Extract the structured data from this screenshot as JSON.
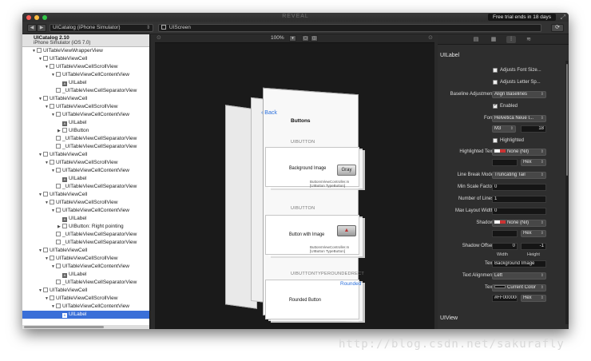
{
  "window": {
    "app_title": "REVEAL",
    "trial_text": "Free trial ends in 18 days"
  },
  "toolbar": {
    "app_selector": "UICatalog (iPhone Simulator)",
    "breadcrumb": "UIScreen"
  },
  "tree": {
    "app_name": "UICatalog 2.10",
    "device": "iPhone Simulator (iOS 7.0)",
    "nodes": [
      {
        "indent": 52,
        "tw": "▼",
        "icon": "box",
        "label": "UITableViewWrapperView"
      },
      {
        "indent": 60,
        "tw": "▼",
        "icon": "box",
        "label": "UITableViewCell"
      },
      {
        "indent": 68,
        "tw": "▼",
        "icon": "box",
        "label": "UITableViewCellScrollView"
      },
      {
        "indent": 76,
        "tw": "▼",
        "icon": "dash",
        "label": "UITableViewCellContentView"
      },
      {
        "indent": 84,
        "tw": "",
        "icon": "lbl",
        "label": "UILabel"
      },
      {
        "indent": 76,
        "tw": "",
        "icon": "dash",
        "label": "_UITableViewCellSeparatorView"
      },
      {
        "indent": 60,
        "tw": "▼",
        "icon": "box",
        "label": "UITableViewCell"
      },
      {
        "indent": 68,
        "tw": "▼",
        "icon": "box",
        "label": "UITableViewCellScrollView"
      },
      {
        "indent": 76,
        "tw": "▼",
        "icon": "dash",
        "label": "UITableViewCellContentView"
      },
      {
        "indent": 84,
        "tw": "",
        "icon": "lbl",
        "label": "UILabel"
      },
      {
        "indent": 84,
        "tw": "▶",
        "icon": "box",
        "label": "UIButton"
      },
      {
        "indent": 76,
        "tw": "",
        "icon": "dash",
        "label": "_UITableViewCellSeparatorView"
      },
      {
        "indent": 76,
        "tw": "",
        "icon": "dash",
        "label": "_UITableViewCellSeparatorView"
      },
      {
        "indent": 60,
        "tw": "▼",
        "icon": "box",
        "label": "UITableViewCell"
      },
      {
        "indent": 68,
        "tw": "▼",
        "icon": "box",
        "label": "UITableViewCellScrollView"
      },
      {
        "indent": 76,
        "tw": "▼",
        "icon": "dash",
        "label": "UITableViewCellContentView"
      },
      {
        "indent": 84,
        "tw": "",
        "icon": "lbl",
        "label": "UILabel"
      },
      {
        "indent": 76,
        "tw": "",
        "icon": "dash",
        "label": "_UITableViewCellSeparatorView"
      },
      {
        "indent": 60,
        "tw": "▼",
        "icon": "box",
        "label": "UITableViewCell"
      },
      {
        "indent": 68,
        "tw": "▼",
        "icon": "box",
        "label": "UITableViewCellScrollView"
      },
      {
        "indent": 76,
        "tw": "▼",
        "icon": "dash",
        "label": "UITableViewCellContentView"
      },
      {
        "indent": 84,
        "tw": "",
        "icon": "lbl",
        "label": "UILabel"
      },
      {
        "indent": 84,
        "tw": "▶",
        "icon": "box",
        "label": "UIButton: Right pointing"
      },
      {
        "indent": 76,
        "tw": "",
        "icon": "dash",
        "label": "_UITableViewCellSeparatorView"
      },
      {
        "indent": 76,
        "tw": "",
        "icon": "dash",
        "label": "_UITableViewCellSeparatorView"
      },
      {
        "indent": 60,
        "tw": "▼",
        "icon": "box",
        "label": "UITableViewCell"
      },
      {
        "indent": 68,
        "tw": "▼",
        "icon": "box",
        "label": "UITableViewCellScrollView"
      },
      {
        "indent": 76,
        "tw": "▼",
        "icon": "dash",
        "label": "UITableViewCellContentView"
      },
      {
        "indent": 84,
        "tw": "",
        "icon": "lbl",
        "label": "UILabel"
      },
      {
        "indent": 76,
        "tw": "",
        "icon": "dash",
        "label": "_UITableViewCellSeparatorView"
      },
      {
        "indent": 60,
        "tw": "▼",
        "icon": "box",
        "label": "UITableViewCell"
      },
      {
        "indent": 68,
        "tw": "▼",
        "icon": "box",
        "label": "UITableViewCellScrollView"
      },
      {
        "indent": 76,
        "tw": "▼",
        "icon": "dash",
        "label": "UITableViewCellContentView"
      },
      {
        "indent": 84,
        "tw": "",
        "icon": "lbl",
        "label": "UILabel",
        "selected": true
      }
    ]
  },
  "canvas": {
    "zoom": "100%",
    "screen": {
      "back": "Back",
      "title": "Buttons",
      "sections": [
        {
          "header": "UIBUTTON",
          "cell_text": "Background Image",
          "button": "Gray",
          "sub1": "ButtonsViewController.m",
          "sub2": "[UIButton TypeButton]"
        },
        {
          "header": "UIBUTTON",
          "cell_text": "Button with Image",
          "button": "",
          "sub1": "ButtonsViewController.m",
          "sub2": "[UIButton TypeButton]"
        },
        {
          "header": "UIBUTTONTYPEROUNDEDRECT",
          "cell_text": "Rounded Button",
          "button": "Rounded"
        }
      ]
    }
  },
  "inspector": {
    "section": "UILabel",
    "next_section": "UIView",
    "adjusts_font_size": "Adjusts Font Size...",
    "adjusts_letter_spacing": "Adjusts Letter Sp...",
    "baseline_adjustment_label": "Baseline Adjustment",
    "baseline_adjustment_value": "Align Baselines",
    "enabled": "Enabled",
    "font_label": "Font",
    "font_value": "Helvetica Neue I...",
    "font_style": "M3",
    "font_size": "18",
    "highlighted": "Highlighted",
    "highlighted_text_label": "Highlighted Text",
    "highlighted_text_value": "None (Nil)",
    "hex": "Hex",
    "line_break_label": "Line Break Mode",
    "line_break_value": "Truncating Tail",
    "min_scale_label": "Min Scale Factor",
    "min_scale_value": "0",
    "lines_label": "Number of Lines",
    "lines_value": "1",
    "max_width_label": "Max Layout Width",
    "max_width_value": "0",
    "shadow_label": "Shadow",
    "shadow_value": "None (Nil)",
    "shadow_offset_label": "Shadow Offset",
    "shadow_offset_w": "0",
    "shadow_offset_h": "-1",
    "width_label": "Width",
    "height_label": "Height",
    "text_label": "Text",
    "text_value": "Background Image",
    "text_alignment_label": "Text Alignment",
    "text_alignment_value": "Left",
    "text_color_label": "Text",
    "text_color_value": "Current Color",
    "text_color_hex": "#FF000000"
  },
  "watermark": "http://blog.csdn.net/sakurafly",
  "colors": {
    "selection": "#3a6fd8",
    "link": "#2a6fdc",
    "background": "#2b2b2b"
  }
}
